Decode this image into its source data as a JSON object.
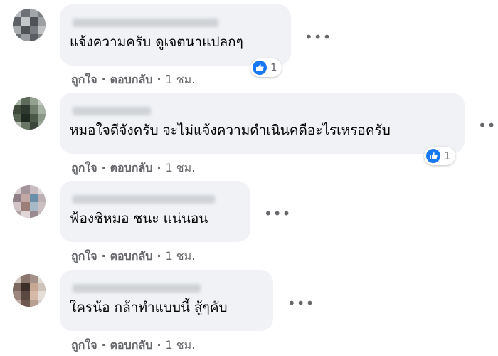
{
  "comments": [
    {
      "text": "แจ้งความครับ ดูเจตนาแปลกๆ",
      "like_label": "ถูกใจ",
      "reply_label": "ตอบกลับ",
      "time": "1 ชม.",
      "reaction_count": "1",
      "separator": "·"
    },
    {
      "text": "หมอใจดีจังครับ จะไม่แจ้งความดำเนินคดีอะไรเหรอครับ",
      "like_label": "ถูกใจ",
      "reply_label": "ตอบกลับ",
      "time": "1 ชม.",
      "reaction_count": "1",
      "separator": "·"
    },
    {
      "text": "ฟ้องซิหมอ ชนะ แน่นอน",
      "like_label": "ถูกใจ",
      "reply_label": "ตอบกลับ",
      "time": "1 ชม.",
      "separator": "·"
    },
    {
      "text": "ใครน้อ กล้าทำแบบนี้ สู้ๆคับ",
      "like_label": "ถูกใจ",
      "reply_label": "ตอบกลับ",
      "time": "1 ชม.",
      "separator": "·"
    }
  ],
  "more_icon": "more-options-icon",
  "colors": {
    "bubble": "#f0f2f5",
    "meta_text": "#65676b",
    "like_blue": "#1877f2"
  }
}
